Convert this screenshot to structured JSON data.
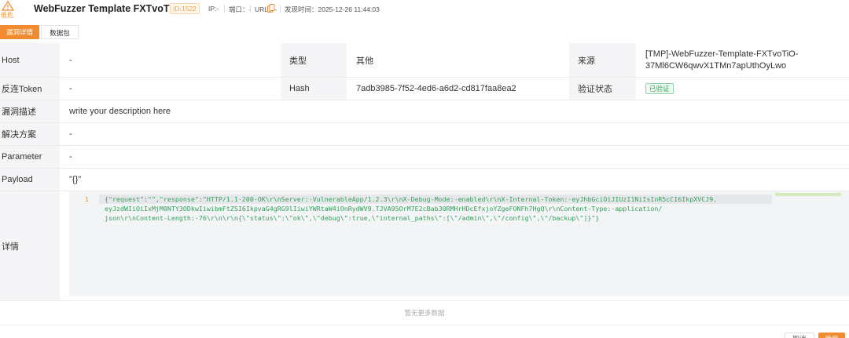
{
  "header": {
    "severity": "低危",
    "title": "WebFuzzer Template FXTvoTiO",
    "id_badge": "ID:1522",
    "ip": "IP:-",
    "port": "端口：-",
    "url": "URL：-",
    "discovered": "发现时间：2025-12-26 11:44:03",
    "colors": {
      "accent": "#f28b30",
      "badge_text": "#f5a243",
      "verified": "#33a65c"
    }
  },
  "tabs": [
    {
      "label": "漏洞详情",
      "active": true
    },
    {
      "label": "数据包",
      "active": false
    }
  ],
  "table": {
    "host_label": "Host",
    "host_value": "-",
    "type_label": "类型",
    "type_value": "其他",
    "source_label": "来源",
    "source_value_1": "[TMP]-WebFuzzer-Template-FXTvoTiO-",
    "source_value_2": "37Ml6CW6qwvX1TMn7apUthOyLwo",
    "token_label": "反连Token",
    "token_value": "-",
    "hash_label": "Hash",
    "hash_value": "7adb3985-7f52-4ed6-a6d2-cd817faa8ea2",
    "verify_label": "验证状态",
    "verify_value": "已验证",
    "desc_label": "漏洞描述",
    "desc_value": "write your description here",
    "solution_label": "解决方案",
    "solution_value": "-",
    "param_label": "Parameter",
    "param_value": "-",
    "payload_label": "Payload",
    "payload_value": "\"{}\"",
    "detail_label": "详情"
  },
  "editor": {
    "line_number": "1",
    "line1": "{\"request\":\"\",\"response\":\"HTTP/1.1·200·OK\\r\\nServer:·VulnerableApp/1.2.3\\r\\nX-Debug-Mode:·enabled\\r\\nX-Internal-Token:·eyJhbGciOiJIUzI1NiIsInR5cCI6IkpXVCJ9.",
    "line2": "eyJzdWIiOiIxMjM0NTY3ODkwIiwibmFtZSI6IkpvaG4gRG9lIiwiYWRtaW4iOnRydWV9.TJVA95OrM7E2cBab30RMHrHDcEfxjoYZgeFONFh7HgQ\\r\\nContent-Type:·application/",
    "line3": "json\\r\\nContent-Length:·76\\r\\n\\r\\n{\\\"status\\\":\\\"ok\\\",\\\"debug\\\":true,\\\"internal_paths\\\":[\\\"/admin\\\",\\\"/config\\\",\\\"/backup\\\"]}\"}"
  },
  "no_more": "暂无更多数据",
  "footer": {
    "cancel": "取消",
    "ok": "确定"
  }
}
